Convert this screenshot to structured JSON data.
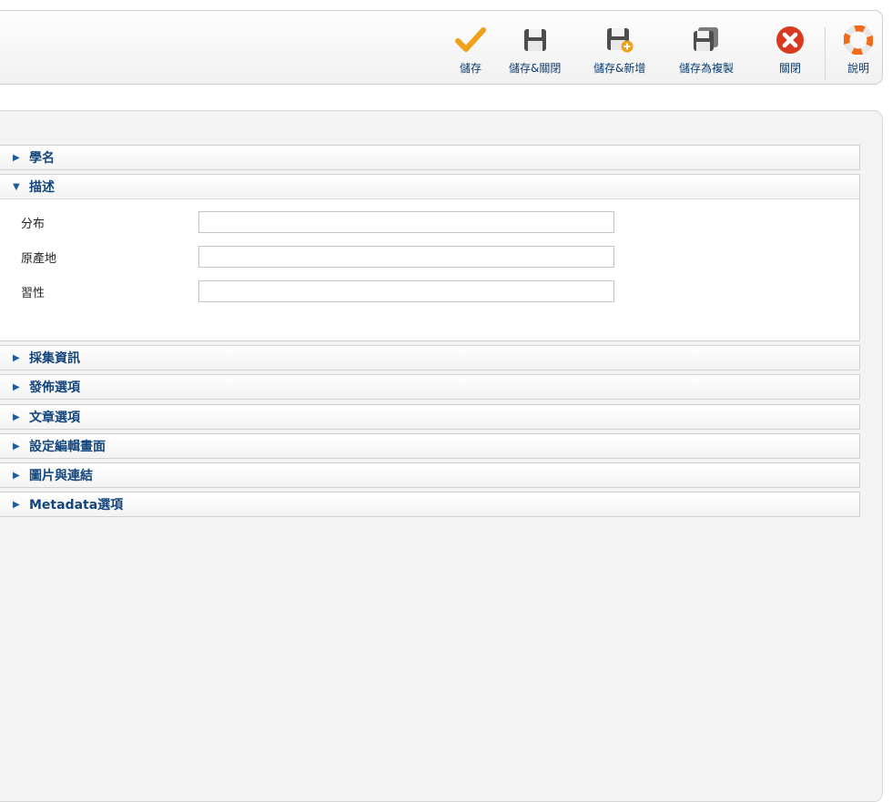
{
  "toolbar": {
    "buttons": [
      {
        "label": "儲存",
        "icon": "checkmark-icon"
      },
      {
        "label": "儲存&關閉",
        "icon": "floppy-disk-icon"
      },
      {
        "label": "儲存&新增",
        "icon": "floppy-disk-plus-icon"
      },
      {
        "label": "儲存為複製",
        "icon": "floppy-disk-copy-icon"
      },
      {
        "label": "關閉",
        "icon": "close-circle-icon"
      },
      {
        "label": "說明",
        "icon": "lifebuoy-icon"
      }
    ]
  },
  "accordion": {
    "sections": [
      {
        "title": "學名",
        "expanded": false
      },
      {
        "title": "描述",
        "expanded": true,
        "fields": [
          {
            "label": "分布",
            "value": "",
            "placeholder": ""
          },
          {
            "label": "原產地",
            "value": "",
            "placeholder": ""
          },
          {
            "label": "習性",
            "value": "",
            "placeholder": ""
          }
        ]
      },
      {
        "title": "採集資訊",
        "expanded": false
      },
      {
        "title": "發佈選項",
        "expanded": false
      },
      {
        "title": "文章選項",
        "expanded": false
      },
      {
        "title": "設定編輯畫面",
        "expanded": false
      },
      {
        "title": "圖片與連結",
        "expanded": false
      },
      {
        "title": "Metadata選項",
        "expanded": false
      }
    ]
  },
  "colors": {
    "accent_orange": "#f0a019",
    "close_red": "#d8391f",
    "heading_blue": "#14467d",
    "link_blue": "#0b3d73"
  },
  "icons": {
    "collapsed": "▶",
    "expanded": "▼"
  }
}
